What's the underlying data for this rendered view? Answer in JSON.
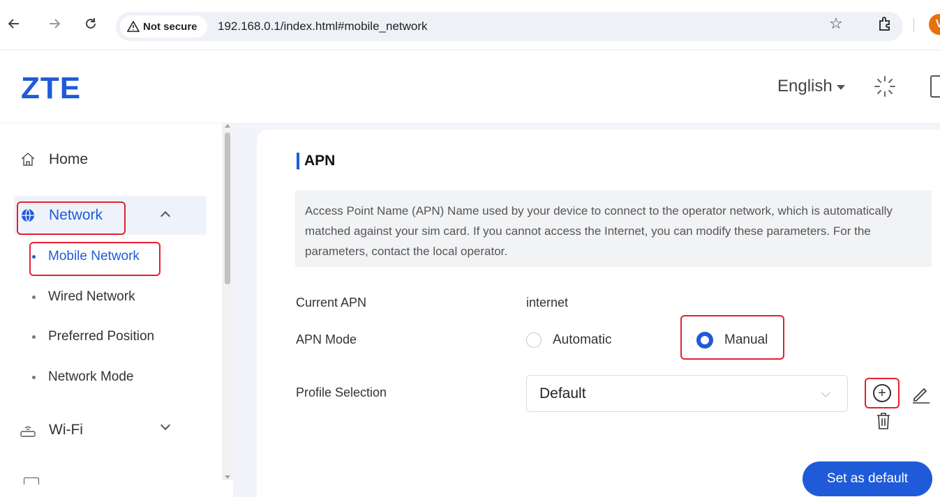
{
  "browser": {
    "security_label": "Not secure",
    "url": "192.168.0.1/index.html#mobile_network",
    "back_icon": "back-arrow-icon",
    "forward_icon": "forward-arrow-icon",
    "reload_icon": "reload-icon",
    "bookmark_icon": "star-icon",
    "extensions_icon": "puzzle-icon",
    "profile_initial": "V"
  },
  "header": {
    "logo": "ZTE",
    "language": "English",
    "brand_color": "#1f5bd8"
  },
  "sidebar": {
    "items": [
      {
        "label": "Home",
        "icon": "home-icon"
      },
      {
        "label": "Network",
        "icon": "globe-icon",
        "expanded": true
      },
      {
        "label": "Wi-Fi",
        "icon": "router-icon",
        "expanded": false
      }
    ],
    "network_subitems": [
      {
        "label": "Mobile Network",
        "active": true
      },
      {
        "label": "Wired Network",
        "active": false
      },
      {
        "label": "Preferred Position",
        "active": false
      },
      {
        "label": "Network Mode",
        "active": false
      }
    ]
  },
  "main": {
    "title": "APN",
    "description": "Access Point Name (APN) Name used by your device to connect to the operator network, which is automatically matched against your sim card. If you cannot access the Internet, you can modify these parameters. For the parameters, contact the local operator.",
    "current_apn_label": "Current APN",
    "current_apn_value": "internet",
    "apn_mode_label": "APN Mode",
    "apn_mode_options": [
      "Automatic",
      "Manual"
    ],
    "apn_mode_selected": "Manual",
    "profile_label": "Profile Selection",
    "profile_value": "Default",
    "set_default_button": "Set as default"
  }
}
